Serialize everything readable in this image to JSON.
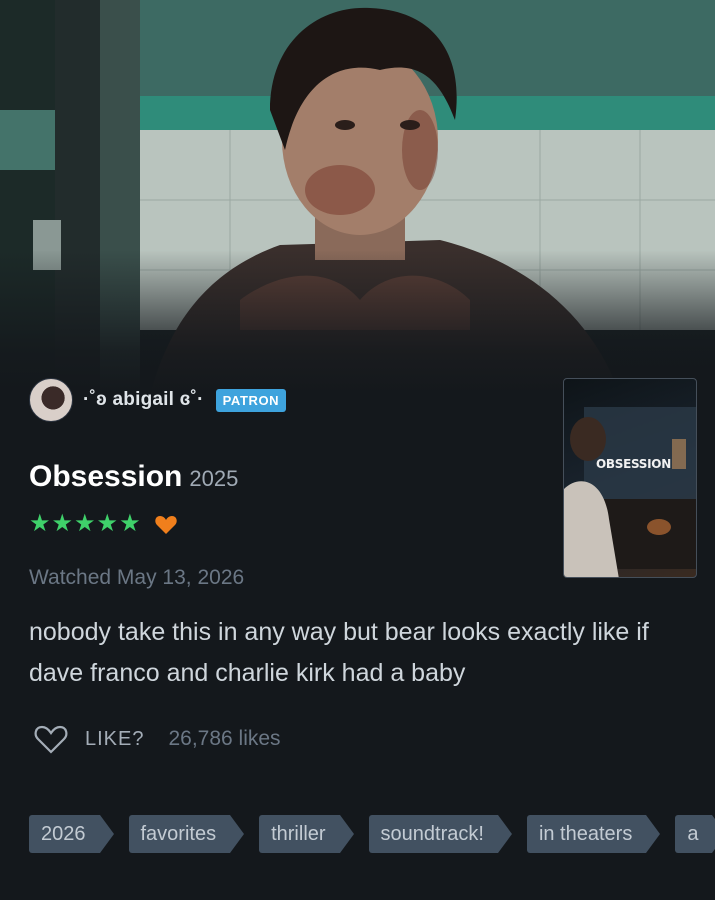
{
  "user": {
    "name": "·˚ʚ abigail ɞ˚·",
    "badge": "PATRON"
  },
  "film": {
    "title": "Obsession",
    "year": "2025",
    "poster_title": "OBSESSION"
  },
  "rating": {
    "stars": "★★★★★",
    "value": 5,
    "liked": true,
    "star_color": "#3fd16a",
    "heart_color": "#f07f1c"
  },
  "watched": "Watched May 13, 2026",
  "review": "nobody take this in any way but bear looks exactly like if dave franco and charlie kirk had a baby",
  "likes": {
    "label": "LIKE?",
    "count": "26,786 likes"
  },
  "tags": [
    "2026",
    "favorites",
    "thriller",
    "soundtrack!",
    "in theaters",
    "a"
  ],
  "colors": {
    "background": "#14181c",
    "patron": "#3ea3dd",
    "tag_bg": "#425161"
  }
}
